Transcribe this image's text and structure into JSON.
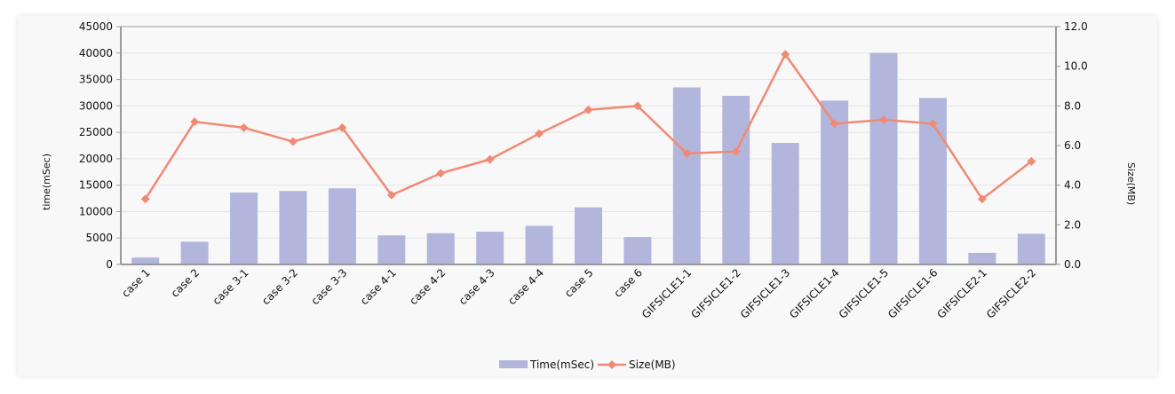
{
  "chart_data": {
    "type": "bar+line",
    "categories": [
      "case 1",
      "case 2",
      "case 3-1",
      "case 3-2",
      "case 3-3",
      "case 4-1",
      "case 4-2",
      "case 4-3",
      "case 4-4",
      "case 5",
      "case 6",
      "GIFSICLE1-1",
      "GIFSICLE1-2",
      "GIFSICLE1-3",
      "GIFSICLE1-4",
      "GIFSICLE1-5",
      "GIFSICLE1-6",
      "GIFSICLE2-1",
      "GIFSICLE2-2"
    ],
    "series": [
      {
        "name": "Time(mSec)",
        "kind": "bar",
        "axis": "left",
        "color": "#b3b6dc",
        "values": [
          1300,
          4300,
          13600,
          13900,
          14400,
          5500,
          5900,
          6200,
          7300,
          10800,
          5200,
          33500,
          31900,
          23000,
          31000,
          40000,
          31500,
          2200,
          5800
        ]
      },
      {
        "name": "Size(MB)",
        "kind": "line",
        "axis": "right",
        "color": "#f08a75",
        "values": [
          3.3,
          7.2,
          6.9,
          6.2,
          6.9,
          3.5,
          4.6,
          5.3,
          6.6,
          7.8,
          8.0,
          5.6,
          5.7,
          10.6,
          7.1,
          7.3,
          7.1,
          3.3,
          5.2
        ]
      }
    ],
    "ylabel_left": "time(mSec)",
    "ylabel_right": "Size(MB)",
    "ylim_left": [
      0,
      45000
    ],
    "ylim_right": [
      0,
      12.0
    ],
    "yticks_left": [
      "0",
      "5000",
      "10000",
      "15000",
      "20000",
      "25000",
      "30000",
      "35000",
      "40000",
      "45000"
    ],
    "yticks_right": [
      "0.0",
      "2.0",
      "4.0",
      "6.0",
      "8.0",
      "10.0",
      "12.0"
    ],
    "grid": true,
    "legend_position": "bottom-center"
  }
}
